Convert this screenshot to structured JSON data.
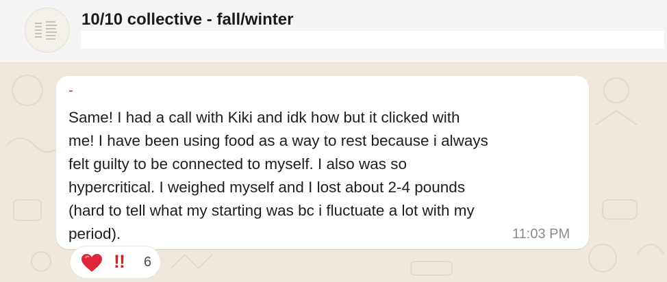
{
  "chat": {
    "title": "10/10 collective - fall/winter",
    "avatar_icon": "group-collective-icon"
  },
  "message": {
    "lines": [
      "Same! I had a call with Kiki and idk how but it clicked with",
      "me! I have been using food as a way to rest because i always",
      "felt guilty to be connected to myself. I also was so",
      "hypercritical. I weighed myself and I lost about 2-4 pounds",
      "(hard to tell what my starting was bc i fluctuate a lot with my",
      "period)."
    ],
    "time": "11:03 PM"
  },
  "reactions": {
    "emojis": [
      "heart-icon",
      "double-exclamation-icon"
    ],
    "bang_glyph": "!!",
    "count": "6"
  },
  "colors": {
    "background": "#efe7dc",
    "bubble": "#ffffff",
    "header": "#f5f5f5",
    "heart": "#e0263a",
    "exclamation": "#d81e1e"
  }
}
